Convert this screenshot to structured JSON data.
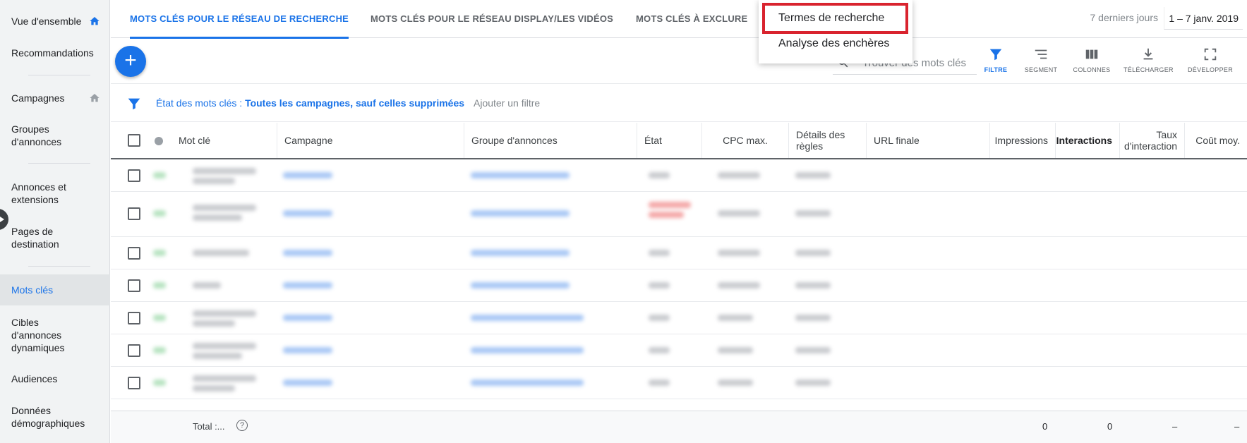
{
  "sidebar": {
    "items": [
      {
        "label": "Vue d'ensemble",
        "home": true
      },
      {
        "label": "Recommandations"
      },
      {
        "label": "Campagnes",
        "home": true
      },
      {
        "label": "Groupes d'annonces"
      },
      {
        "label": "Annonces et extensions"
      },
      {
        "label": "Pages de destination"
      },
      {
        "label": "Mots clés",
        "active": true
      },
      {
        "label": "Cibles d'annonces dynamiques"
      },
      {
        "label": "Audiences"
      },
      {
        "label": "Données démographiques"
      }
    ]
  },
  "tabs": [
    {
      "label": "MOTS CLÉS POUR LE RÉSEAU DE RECHERCHE",
      "active": true
    },
    {
      "label": "MOTS CLÉS POUR LE RÉSEAU DISPLAY/LES VIDÉOS"
    },
    {
      "label": "MOTS CLÉS À EXCLURE"
    }
  ],
  "dropdown": {
    "items": [
      "Termes de recherche",
      "Analyse des enchères"
    ]
  },
  "date": {
    "label": "7 derniers jours",
    "value": "1 – 7 janv. 2019"
  },
  "toolbar": {
    "add_symbol": "+",
    "search_placeholder": "Trouver des mots clés",
    "tools": [
      "FILTRE",
      "SEGMENT",
      "COLONNES",
      "TÉLÉCHARGER",
      "DÉVELOPPER"
    ]
  },
  "filter": {
    "prefix": "État des mots clés : ",
    "value": "Toutes les campagnes, sauf celles supprimées",
    "add": "Ajouter un filtre"
  },
  "table": {
    "headers": {
      "keyword": "Mot clé",
      "campaign": "Campagne",
      "adgroup": "Groupe d'annonces",
      "status": "État",
      "cpc": "CPC max.",
      "rules": "Détails des règles",
      "url": "URL finale",
      "impressions": "Impressions",
      "interactions": "Interactions",
      "rate": "Taux d'interaction",
      "cost": "Coût moy."
    },
    "total": {
      "label": "Total :...",
      "help": "?",
      "impressions": "0",
      "interactions": "0",
      "rate": "–",
      "cost": "–"
    }
  },
  "colors": {
    "accent": "#1a73e8",
    "highlight": "#d9232e"
  }
}
